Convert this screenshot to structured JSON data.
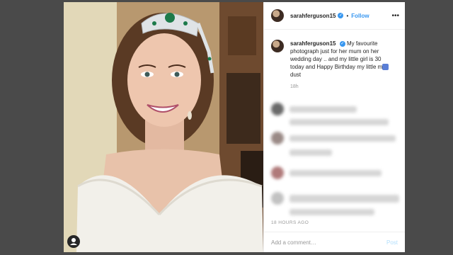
{
  "post": {
    "username": "sarahferguson15",
    "follow_label": "Follow",
    "separator": "•",
    "caption_text_1": "My favourite photograph just for her mum on her wedding day .. and my little girl is 30 today and Happy Birthday my little m",
    "caption_text_2": " dust",
    "caption_age": "18h",
    "timestamp": "18 HOURS AGO",
    "add_comment_placeholder": "Add a comment…",
    "post_label": "Post",
    "more_label": "•••"
  },
  "colors": {
    "link_blue": "#3897f0",
    "verified_blue": "#3897f0",
    "muted_gray": "#999999",
    "post_disabled": "#b2dffc"
  },
  "icons": {
    "verified": "verified-badge-icon",
    "more": "more-options-icon",
    "tag": "user-tag-icon"
  }
}
